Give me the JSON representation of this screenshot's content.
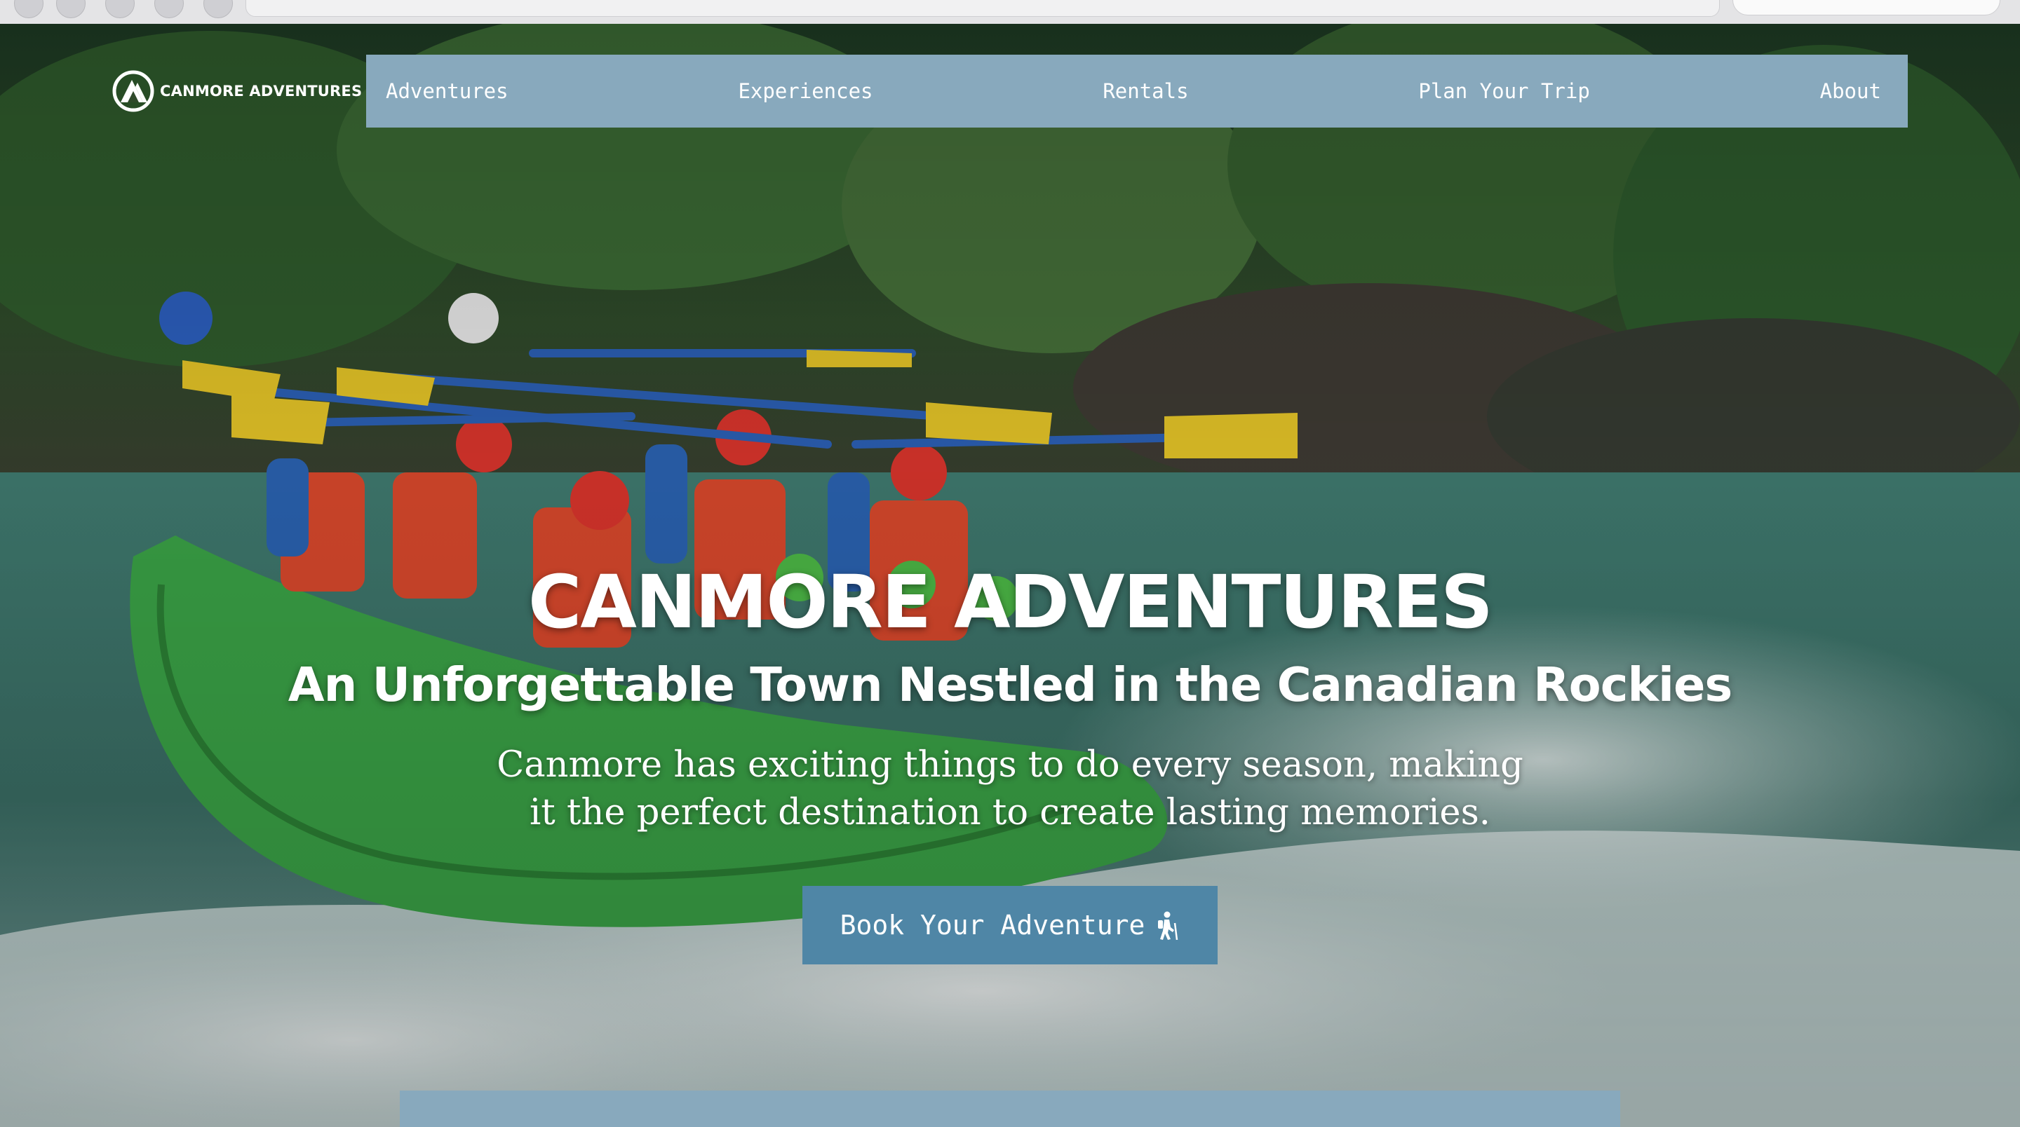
{
  "brand": {
    "logo_text": "CANMORE ADVENTURES",
    "logo_icon": "mountain-circle-logo"
  },
  "nav": {
    "items": [
      {
        "label": "Adventures"
      },
      {
        "label": "Experiences"
      },
      {
        "label": "Rentals"
      },
      {
        "label": "Plan Your Trip"
      },
      {
        "label": "About"
      }
    ]
  },
  "hero": {
    "title": "CANMORE ADVENTURES",
    "subtitle": "An Unforgettable Town Nestled in the Canadian Rockies",
    "lead": "Canmore has exciting things to do every season, making it the perfect destination to create lasting memories.",
    "cta_label": "Book Your Adventure",
    "cta_icon": "hiker-icon",
    "background": "whitewater-rafting-photo"
  },
  "colors": {
    "nav_bg": "#88a9bd",
    "cta_bg": "#4f86a6",
    "text": "#ffffff"
  }
}
